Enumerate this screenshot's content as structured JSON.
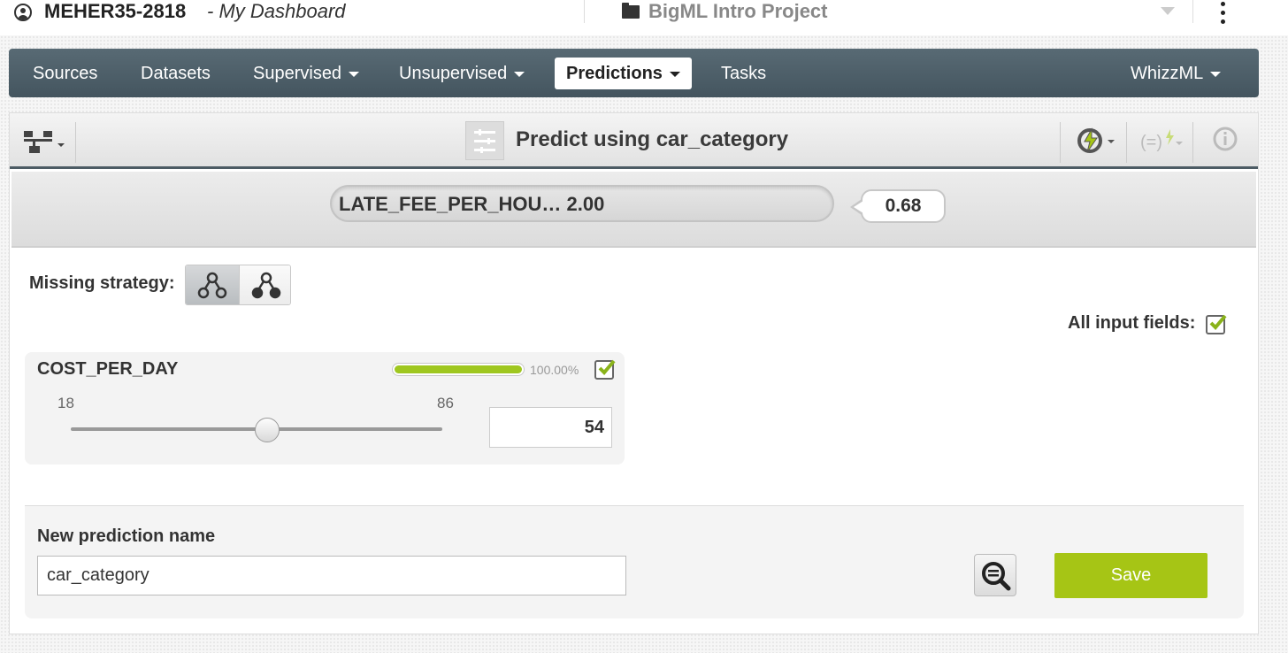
{
  "header": {
    "user": "MEHER35-2818",
    "separator_title": "- My Dashboard",
    "project": "BigML Intro Project"
  },
  "nav": {
    "items": [
      {
        "label": "Sources",
        "has_caret": false
      },
      {
        "label": "Datasets",
        "has_caret": false
      },
      {
        "label": "Supervised",
        "has_caret": true
      },
      {
        "label": "Unsupervised",
        "has_caret": true
      },
      {
        "label": "Predictions",
        "has_caret": true,
        "active": true
      },
      {
        "label": "Tasks",
        "has_caret": false
      },
      {
        "label": "WhizzML",
        "has_caret": true
      }
    ]
  },
  "toolbar": {
    "title": "Predict using car_category"
  },
  "prediction": {
    "input_text": "LATE_FEE_PER_HOU… 2.00",
    "value": "0.68"
  },
  "missing_strategy": {
    "label": "Missing strategy:",
    "selected": "last-prediction"
  },
  "all_input_fields": {
    "label": "All input fields:",
    "checked": true
  },
  "field": {
    "name": "COST_PER_DAY",
    "importance_fraction": 1.0,
    "importance_text": "100.00%",
    "min": "18",
    "max": "86",
    "min_value": 18,
    "max_value": 86,
    "value": "54",
    "checked": true
  },
  "new_prediction": {
    "label": "New prediction name",
    "value": "car_category",
    "save_label": "Save"
  },
  "colors": {
    "accent_green": "#a6c515",
    "nav_bg": "#4c5d67",
    "bar_fill": "#9fc71f"
  },
  "icons": {
    "user": "user-circle-icon",
    "folder": "folder-icon",
    "more": "kebab-menu-icon",
    "tree": "tree-network-icon",
    "model": "ensemble-model-icon",
    "batch": "lightning-cycle-icon",
    "formula": "formula-lightning-icon",
    "info": "info-icon",
    "inspect": "search-inspect-icon"
  }
}
